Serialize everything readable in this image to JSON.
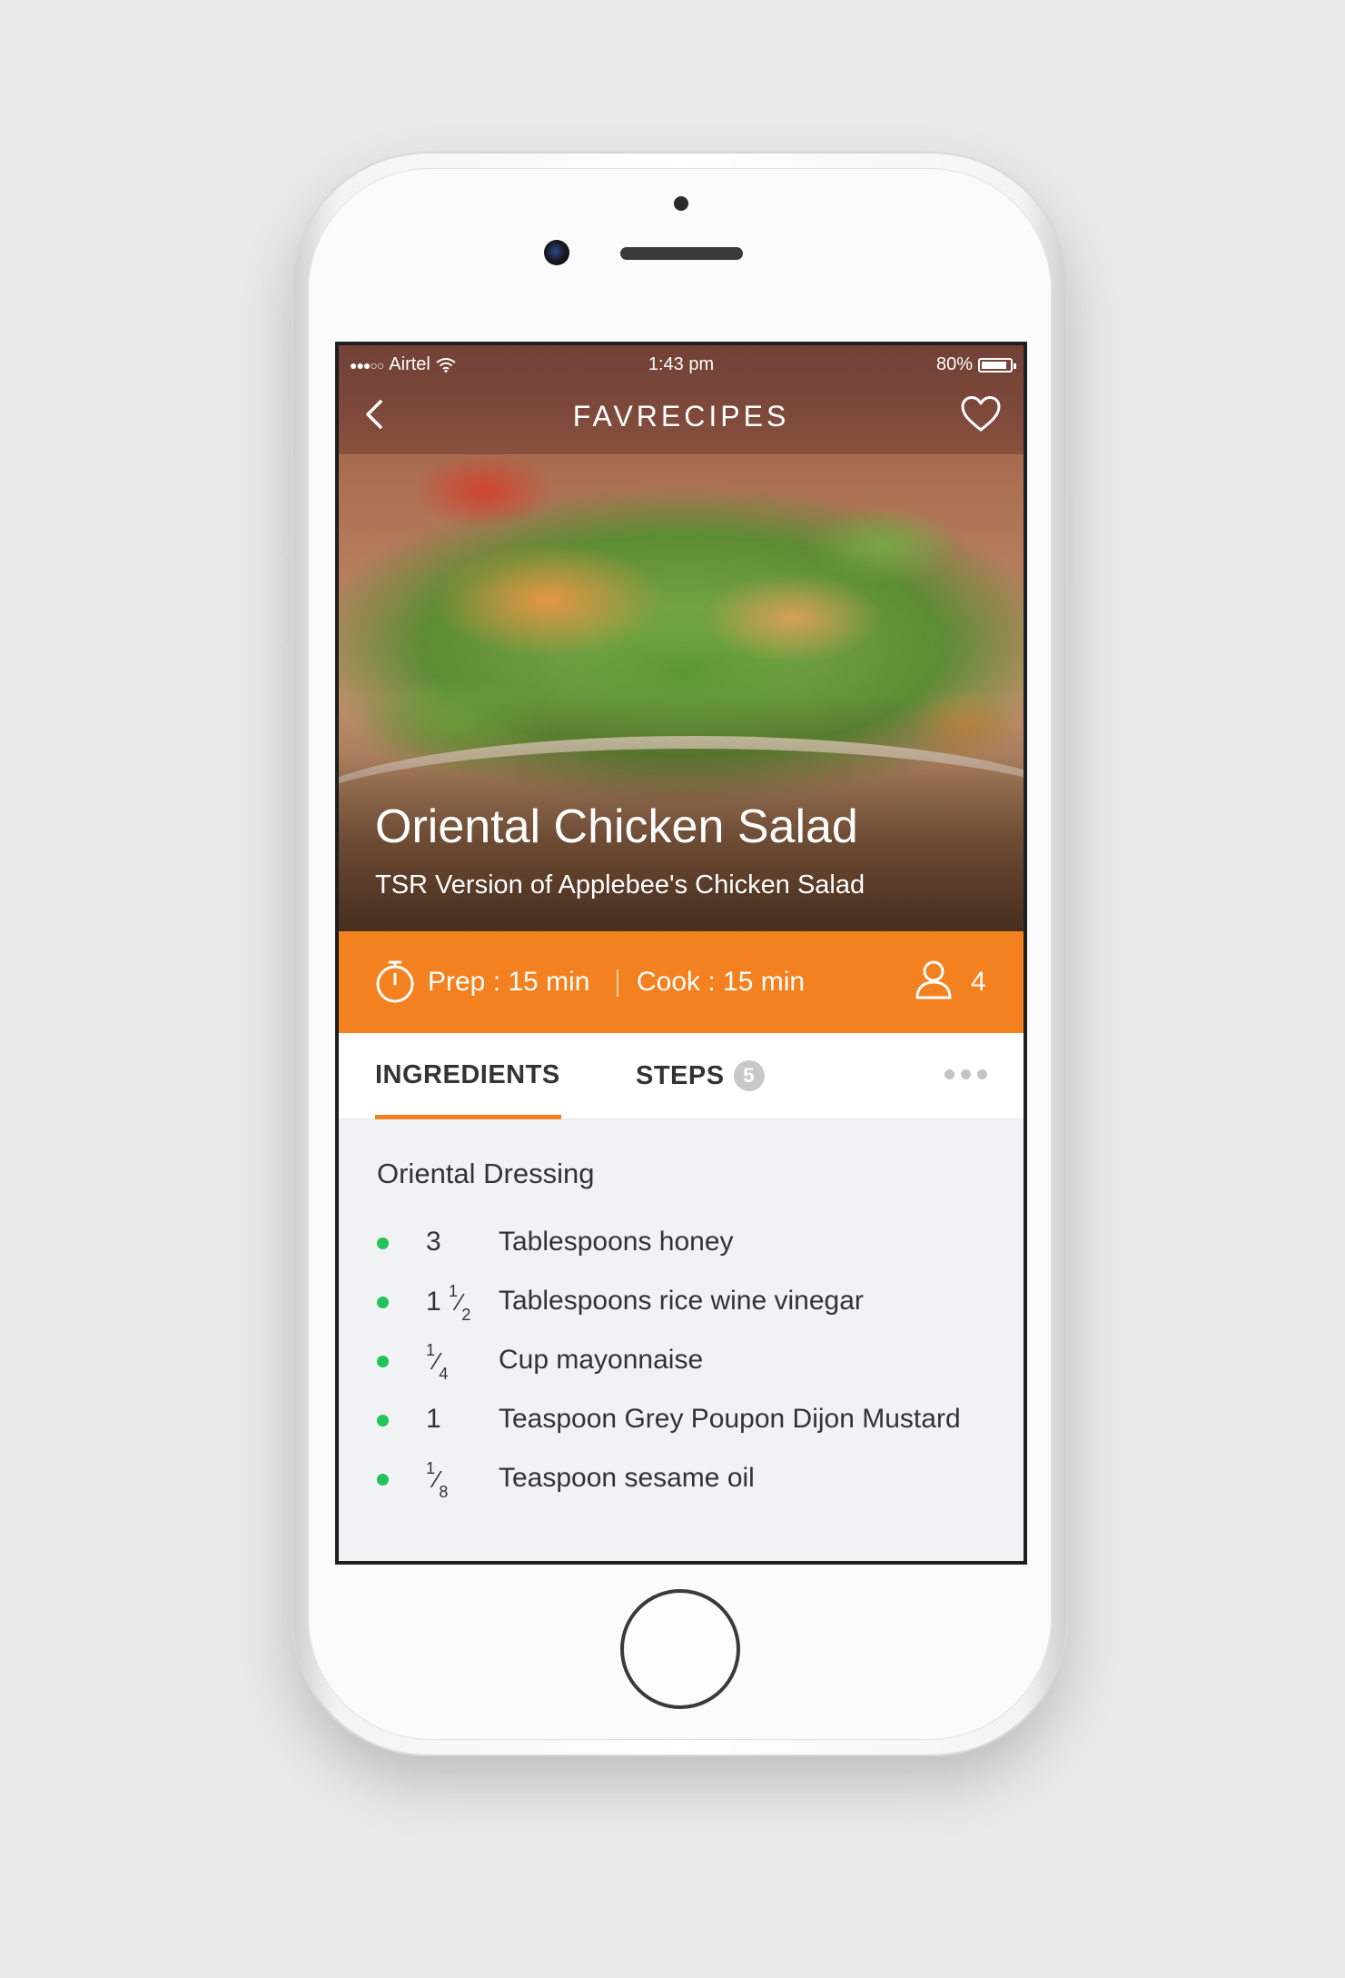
{
  "status_bar": {
    "signal": "●●●○○",
    "carrier": "Airtel",
    "time": "1:43 pm",
    "battery": "80%"
  },
  "navbar": {
    "title": "FAVRECIPES",
    "back_icon": "chevron-left-icon",
    "favorite_icon": "heart-outline-icon"
  },
  "recipe": {
    "title": "Oriental Chicken Salad",
    "subtitle": "TSR Version of Applebee's Chicken Salad"
  },
  "info": {
    "prep": "Prep : 15 min",
    "cook": "Cook : 15 min",
    "servings": "4",
    "accent_color": "#f4811f"
  },
  "tabs": {
    "ingredients": "INGREDIENTS",
    "steps": "STEPS",
    "steps_count": "5"
  },
  "section": {
    "title": "Oriental Dressing",
    "ingredients": [
      {
        "qty_whole": "3",
        "qty_num": "",
        "qty_den": "",
        "item": "Tablespoons honey"
      },
      {
        "qty_whole": "1",
        "qty_num": "1",
        "qty_den": "2",
        "item": "Tablespoons rice wine vinegar"
      },
      {
        "qty_whole": "",
        "qty_num": "1",
        "qty_den": "4",
        "item": "Cup mayonnaise"
      },
      {
        "qty_whole": "1",
        "qty_num": "",
        "qty_den": "",
        "item": "Teaspoon Grey Poupon Dijon Mustard"
      },
      {
        "qty_whole": "",
        "qty_num": "1",
        "qty_den": "8",
        "item": "Teaspoon sesame oil"
      }
    ],
    "bullet_color": "#22c35a"
  }
}
